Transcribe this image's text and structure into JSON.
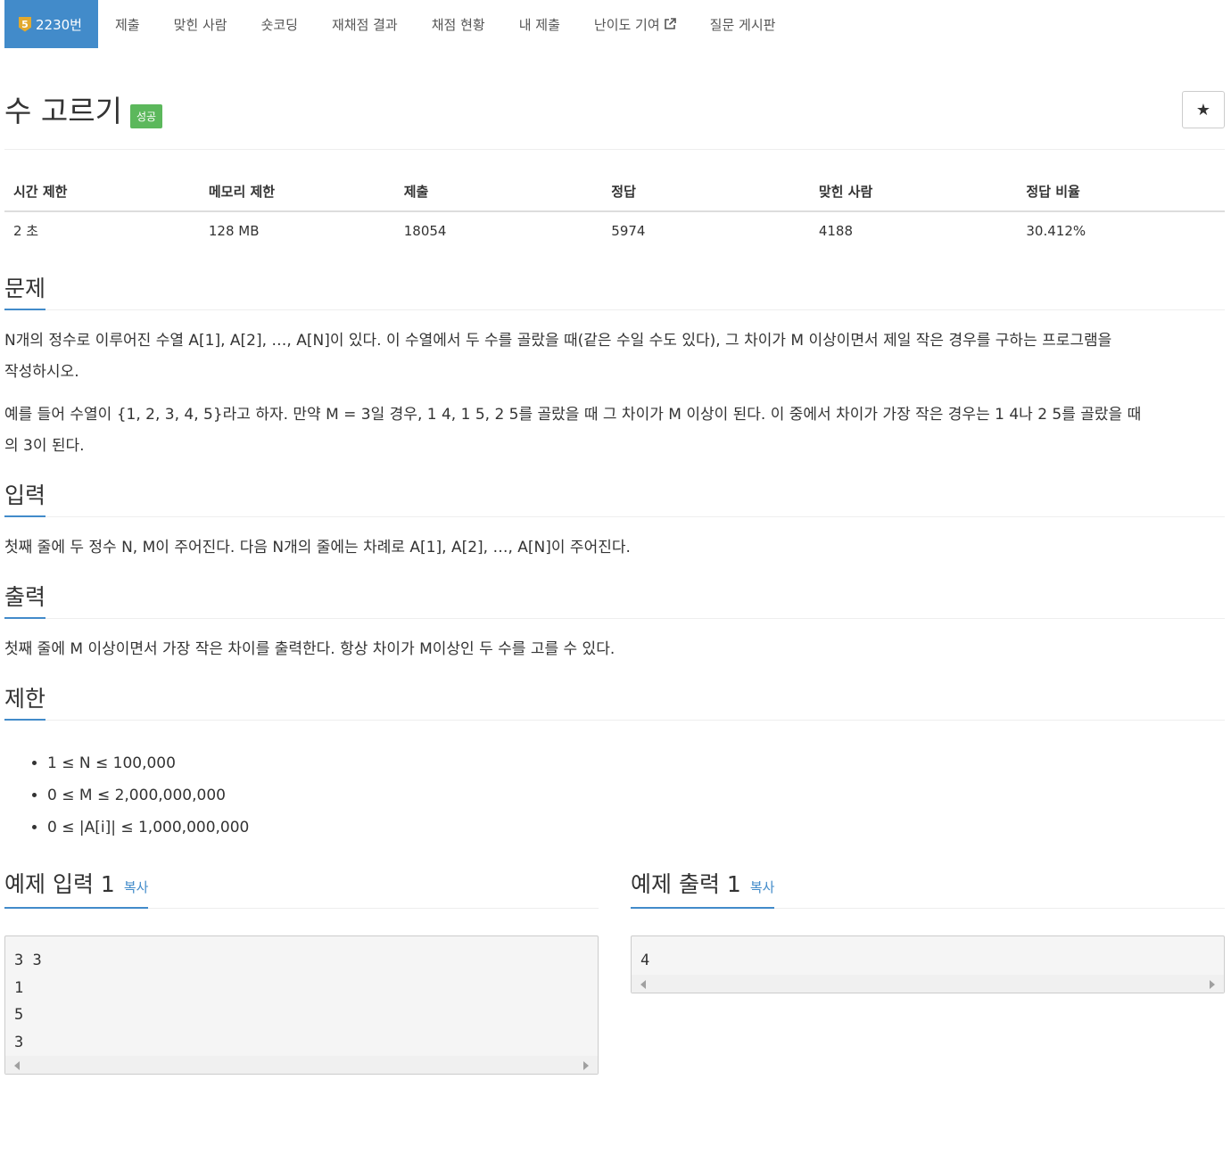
{
  "nav": {
    "problem_badge_tier": "5",
    "problem_id_label": "2230번",
    "items": [
      "제출",
      "맞힌 사람",
      "숏코딩",
      "재채점 결과",
      "채점 현황",
      "내 제출",
      "난이도 기여",
      "질문 게시판"
    ]
  },
  "header": {
    "title": "수 고르기",
    "status_badge": "성공",
    "star": "★"
  },
  "stats": {
    "headers": [
      "시간 제한",
      "메모리 제한",
      "제출",
      "정답",
      "맞힌 사람",
      "정답 비율"
    ],
    "values": [
      "2 초",
      "128 MB",
      "18054",
      "5974",
      "4188",
      "30.412%"
    ]
  },
  "problem": {
    "heading": "문제",
    "p1": "N개의 정수로 이루어진 수열 A[1], A[2], …, A[N]이 있다. 이 수열에서 두 수를 골랐을 때(같은 수일 수도 있다), 그 차이가 M 이상이면서 제일 작은 경우를 구하는 프로그램을",
    "p1b": "작성하시오.",
    "p2": "예를 들어 수열이 {1, 2, 3, 4, 5}라고 하자. 만약 M = 3일 경우, 1 4, 1 5, 2 5를 골랐을 때 그 차이가 M 이상이 된다. 이 중에서 차이가 가장 작은 경우는 1 4나 2 5를 골랐을 때",
    "p2b": "의 3이 된다."
  },
  "input": {
    "heading": "입력",
    "text": "첫째 줄에 두 정수 N, M이 주어진다. 다음 N개의 줄에는 차례로 A[1], A[2], …, A[N]이 주어진다."
  },
  "output": {
    "heading": "출력",
    "text": "첫째 줄에 M 이상이면서 가장 작은 차이를 출력한다. 항상 차이가 M이상인 두 수를 고를 수 있다."
  },
  "limits": {
    "heading": "제한",
    "items": [
      "1 ≤ N ≤ 100,000",
      "0 ≤ M ≤ 2,000,000,000",
      "0 ≤ |A[i]| ≤ 1,000,000,000"
    ]
  },
  "sample_input": {
    "heading": "예제 입력 1",
    "copy": "복사",
    "content": "3 3\n1\n5\n3"
  },
  "sample_output": {
    "heading": "예제 출력 1",
    "copy": "복사",
    "content": "4"
  },
  "colors": {
    "accent": "#428bca",
    "success": "#5cb85c",
    "tier_gold": "#e2a92e"
  }
}
